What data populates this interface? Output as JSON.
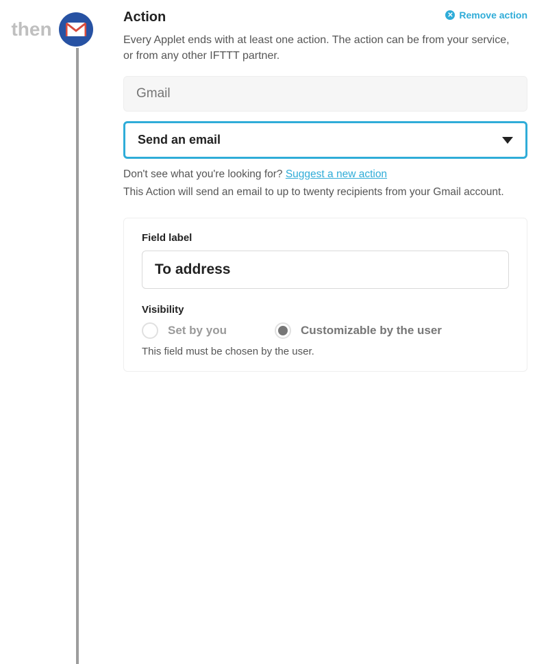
{
  "rail": {
    "then_label": "then"
  },
  "header": {
    "title": "Action",
    "remove_label": "Remove action",
    "description": "Every Applet ends with at least one action. The action can be from your service, or from any other IFTTT partner."
  },
  "service": {
    "value": "Gmail"
  },
  "action_select": {
    "value": "Send an email"
  },
  "suggest": {
    "prefix": "Don't see what you're looking for?  ",
    "link": "Suggest a new action"
  },
  "action_description": "This Action will send an email to up to twenty recipients from your Gmail account.",
  "field": {
    "label_title": "Field label",
    "label_value": "To address",
    "visibility_title": "Visibility",
    "option_a": "Set by you",
    "option_b": "Customizable by the user",
    "note": "This field must be chosen by the user."
  }
}
